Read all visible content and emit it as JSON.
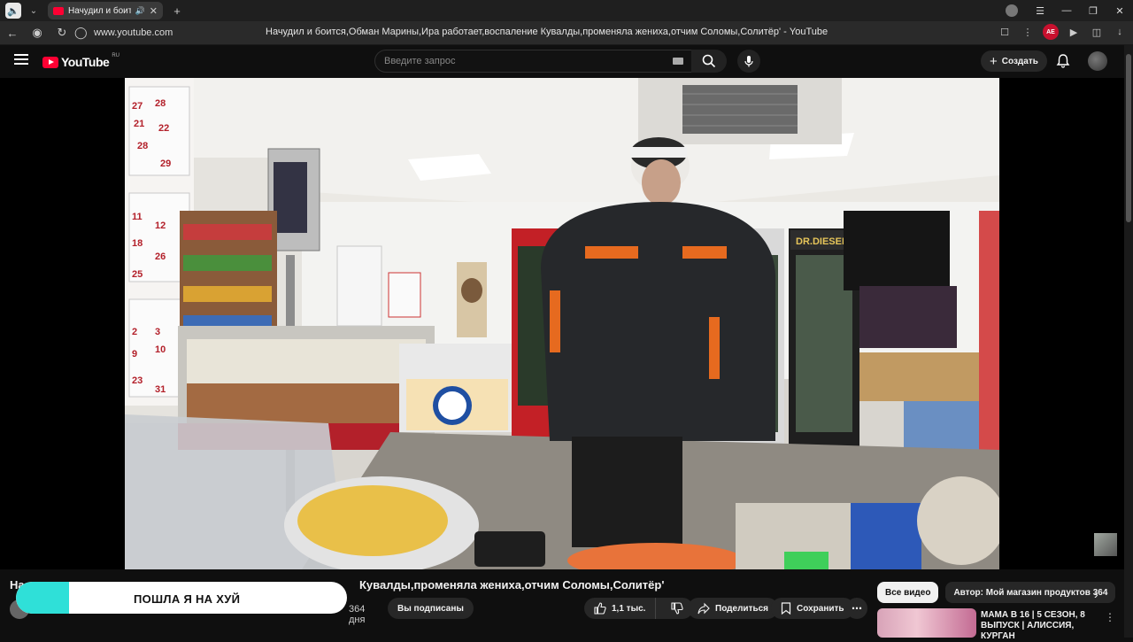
{
  "browser": {
    "tab_title": "Начудил и боится,О",
    "new_tab": "+",
    "url": "www.youtube.com",
    "page_title": "Начудил и боится,Обман Марины,Ира работает,воспаление Кувалды,променяла жениха,отчим Соломы,Солитёр' - YouTube",
    "ext_badge": "AE"
  },
  "header": {
    "logo_text": "YouTube",
    "logo_region": "RU",
    "search_placeholder": "Введите запрос",
    "create_label": "Создать"
  },
  "video": {
    "title_visible": "Кувалды,променяла жениха,отчим Соломы,Солитёр'",
    "title_prefix": "На",
    "channel_meta": "",
    "age": "364 дня",
    "subscribed_label": "Вы подписаны",
    "likes": "1,1 тыс.",
    "share_label": "Поделиться",
    "save_label": "Сохранить"
  },
  "alert": {
    "text": "ПОШЛА Я НА ХУЙ",
    "progress": 0.16
  },
  "recommendations": {
    "chips": [
      "Все видео",
      "Автор: Мой магазин продуктов 364"
    ],
    "item_title": "МАМА В 16 | 5 СЕЗОН, 8 ВЫПУСК | АЛИССИЯ, КУРГАН"
  },
  "colors": {
    "brand_red": "#ff0033",
    "alert_accent": "#2fe0d8",
    "page_bg": "#0f0f0f"
  }
}
